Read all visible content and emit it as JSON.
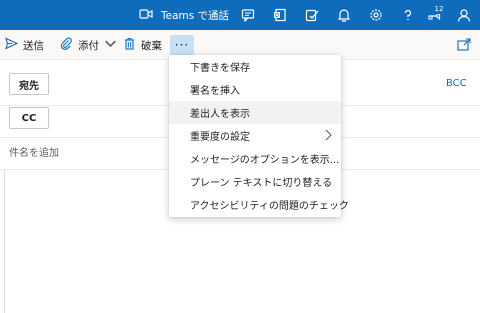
{
  "topbar": {
    "teams_label": "Teams で通話",
    "notification_count": "12",
    "background_color": "#0f6cbd",
    "icons": [
      "video-icon",
      "chat-icon",
      "office-icon",
      "my-day-icon",
      "bell-icon",
      "gear-icon",
      "help-icon",
      "feedback-icon",
      "person-icon"
    ]
  },
  "cmdbar": {
    "send_label": "送信",
    "attach_label": "添付",
    "discard_label": "破棄",
    "more_label": "···"
  },
  "compose": {
    "to_label": "宛先",
    "cc_label": "CC",
    "bcc_label": "BCC",
    "subject_placeholder": "件名を追加"
  },
  "menu": {
    "items": [
      {
        "label": "下書きを保存"
      },
      {
        "label": "署名を挿入"
      },
      {
        "label": "差出人を表示"
      },
      {
        "label": "重要度の設定"
      },
      {
        "label": "メッセージのオプションを表示..."
      },
      {
        "label": "プレーン テキストに切り替える"
      },
      {
        "label": "アクセシビリティの問題のチェック"
      }
    ]
  }
}
